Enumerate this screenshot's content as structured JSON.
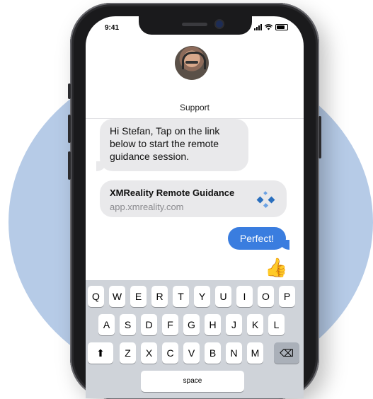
{
  "status_bar": {
    "time": "9:41"
  },
  "contact": {
    "name": "Support"
  },
  "messages": {
    "incoming_text": "Hi Stefan, Tap on the link below to start the remote guidance session.",
    "link_title": "XMReality Remote Guidance",
    "link_url": "app.xmreality.com",
    "outgoing_text": "Perfect!",
    "reaction": "👍"
  },
  "keyboard": {
    "row1": [
      "Q",
      "W",
      "E",
      "R",
      "T",
      "Y",
      "U",
      "I",
      "O",
      "P"
    ],
    "row2": [
      "A",
      "S",
      "D",
      "F",
      "G",
      "H",
      "J",
      "K",
      "L"
    ],
    "row3": [
      "Z",
      "X",
      "C",
      "V",
      "B",
      "N",
      "M"
    ],
    "shift_icon": "⬆",
    "delete_icon": "⌫",
    "space_label": "space"
  },
  "colors": {
    "accent": "#3a7ddf",
    "background_circle": "#b6cbe7"
  }
}
